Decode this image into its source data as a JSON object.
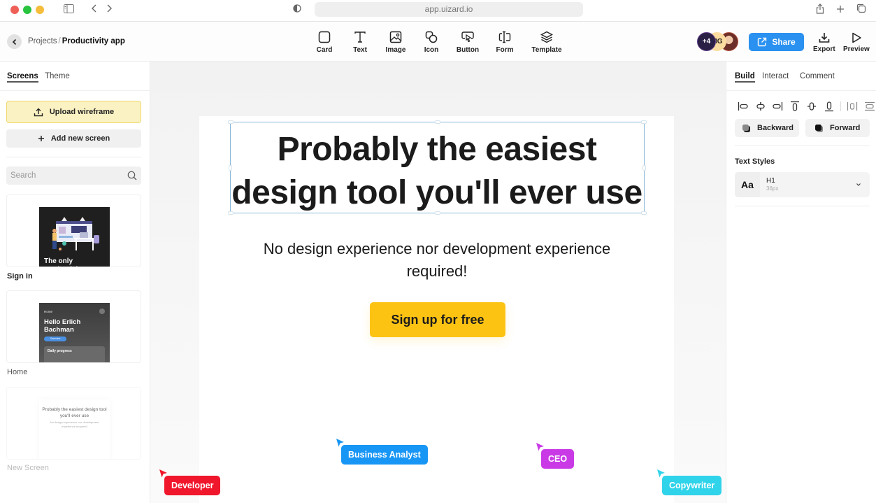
{
  "browser": {
    "url": "app.uizard.io"
  },
  "header": {
    "breadcrumb": {
      "parent": "Projects",
      "separator": "/",
      "current": "Productivity app"
    },
    "tools": [
      {
        "label": "Card",
        "icon": "card-icon"
      },
      {
        "label": "Text",
        "icon": "text-icon"
      },
      {
        "label": "Image",
        "icon": "image-icon"
      },
      {
        "label": "Icon",
        "icon": "shapes-icon"
      },
      {
        "label": "Button",
        "icon": "button-pointer-icon"
      },
      {
        "label": "Form",
        "icon": "form-field-icon"
      },
      {
        "label": "Template",
        "icon": "layers-icon"
      }
    ],
    "collaborators": {
      "more_count": "+4",
      "initials": "MG"
    },
    "share_label": "Share",
    "export_label": "Export",
    "preview_label": "Preview"
  },
  "left_panel": {
    "tabs": [
      {
        "label": "Screens",
        "active": true
      },
      {
        "label": "Theme",
        "active": false
      }
    ],
    "upload_label": "Upload wireframe",
    "add_screen_label": "Add new screen",
    "search_placeholder": "Search",
    "screens": [
      {
        "name": "Sign in",
        "thumb_text": "The only productivity"
      },
      {
        "name": "Home",
        "thumb_title": "Home",
        "thumb_greeting": "Hello Erlich Bachman",
        "thumb_pill": "Overview",
        "thumb_card": "Daily progress"
      },
      {
        "name": "New Screen",
        "thumb_title": "Probably the easiest design tool you'll ever use",
        "thumb_sub": "No design experience nor development experience required!"
      }
    ]
  },
  "canvas": {
    "headline": "Probably the easiest design tool you'll ever use",
    "subtitle": "No design experience nor development experience required!",
    "cta_label": "Sign up for free",
    "cursors": [
      {
        "name": "Developer",
        "color": "#f0162b"
      },
      {
        "name": "Business Analyst",
        "color": "#1896f5"
      },
      {
        "name": "CEO",
        "color": "#c93ae6"
      },
      {
        "name": "Copywriter",
        "color": "#2fd3ea"
      }
    ]
  },
  "right_panel": {
    "tabs": [
      {
        "label": "Build",
        "active": true
      },
      {
        "label": "Interact",
        "active": false
      },
      {
        "label": "Comment",
        "active": false
      }
    ],
    "backward_label": "Backward",
    "forward_label": "Forward",
    "text_styles_title": "Text Styles",
    "text_style": {
      "sample": "Aa",
      "name": "H1",
      "size": "36px"
    }
  },
  "colors": {
    "accent_blue": "#2a91f0",
    "cta_yellow": "#fcc313",
    "upload_bg": "#fbf2c3"
  }
}
